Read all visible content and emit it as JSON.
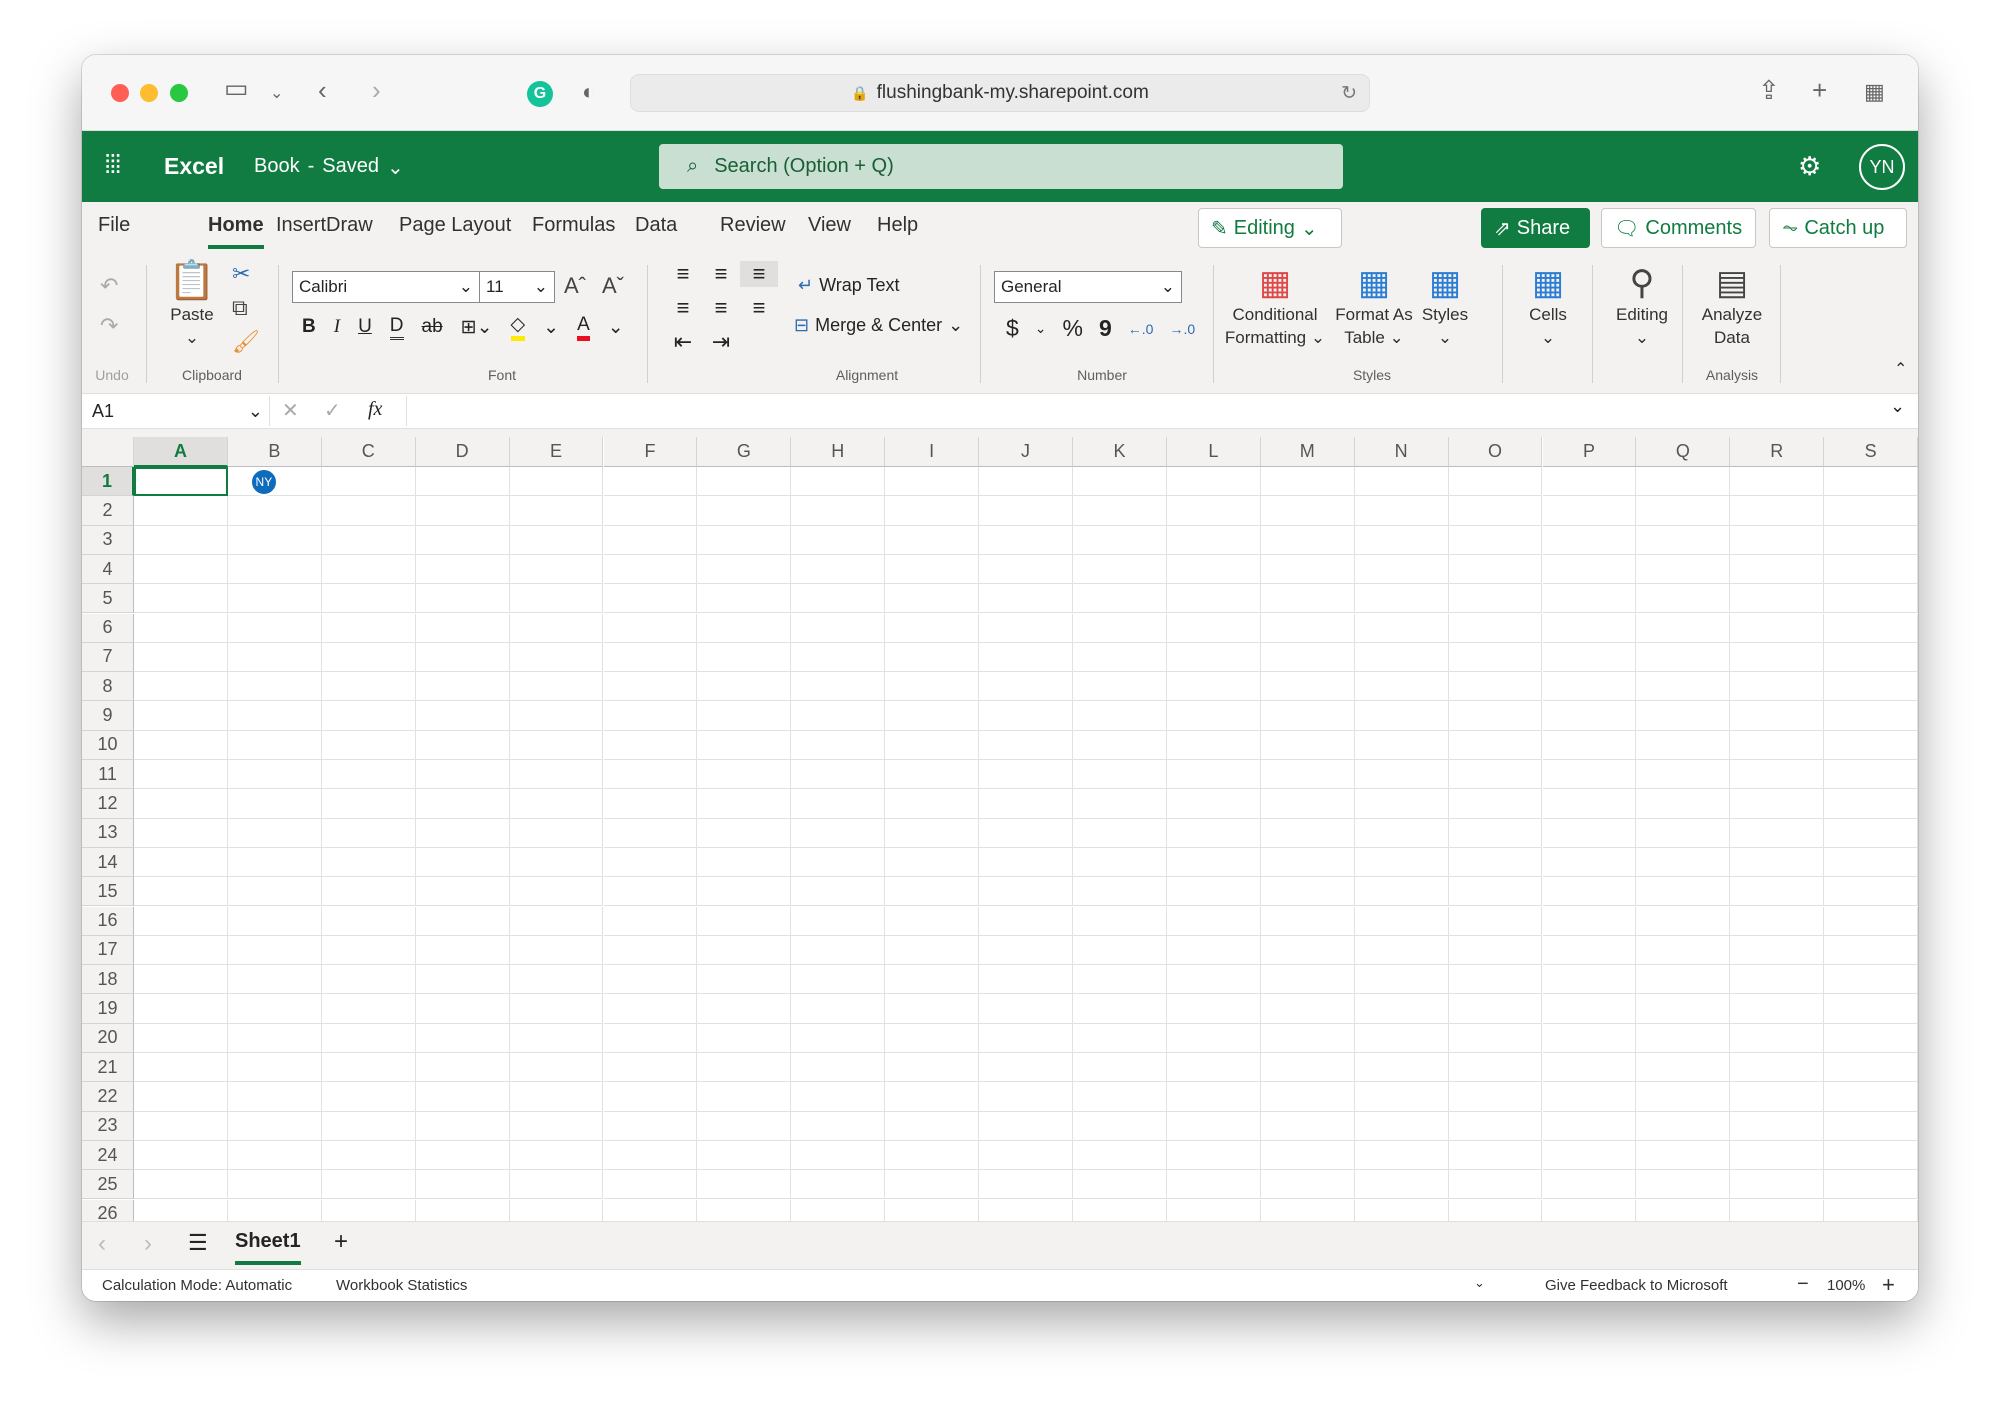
{
  "browser": {
    "url": "flushingbank-my.sharepoint.com",
    "traffic_lights": [
      "#ff5f57",
      "#febc2e",
      "#28c840"
    ]
  },
  "app": {
    "name": "Excel",
    "doc_title": "Book",
    "doc_status": "Saved",
    "separator": "-",
    "search_placeholder": "Search (Option + Q)",
    "user_initials": "YN",
    "brand_color": "#107c41"
  },
  "tabs": [
    {
      "label": "File"
    },
    {
      "label": "Home",
      "active": true
    },
    {
      "label": "Insert"
    },
    {
      "label": "Draw"
    },
    {
      "label": "Page Layout"
    },
    {
      "label": "Formulas"
    },
    {
      "label": "Data"
    },
    {
      "label": "Review"
    },
    {
      "label": "View"
    },
    {
      "label": "Help"
    }
  ],
  "top_buttons": {
    "editing": "Editing",
    "share": "Share",
    "comments": "Comments",
    "catch_up": "Catch up"
  },
  "ribbon": {
    "groups": {
      "undo": "Undo",
      "clipboard": "Clipboard",
      "font": "Font",
      "alignment": "Alignment",
      "number": "Number",
      "styles": "Styles",
      "analysis": "Analysis"
    },
    "paste": "Paste",
    "font_name": "Calibri",
    "font_size": "11",
    "wrap_text": "Wrap Text",
    "merge_center": "Merge & Center",
    "number_format": "General",
    "cond_fmt_1": "Conditional",
    "cond_fmt_2": "Formatting",
    "fmt_table_1": "Format As",
    "fmt_table_2": "Table",
    "styles": "Styles",
    "cells": "Cells",
    "editing": "Editing",
    "analyze_1": "Analyze",
    "analyze_2": "Data",
    "bold": "B",
    "italic": "I",
    "underline": "U",
    "double_underline": "D",
    "strike": "ab",
    "currency": "$",
    "percent": "%",
    "comma": "9"
  },
  "formula_bar": {
    "name_box": "A1",
    "fx": "fx",
    "value": ""
  },
  "grid": {
    "columns": [
      "A",
      "B",
      "C",
      "D",
      "E",
      "F",
      "G",
      "H",
      "I",
      "J",
      "K",
      "L",
      "M",
      "N",
      "O",
      "P",
      "Q",
      "R",
      "S"
    ],
    "rows": 26,
    "selected": "A1",
    "collaborator": {
      "initials": "NY",
      "cell": "B1",
      "color": "#0f6cbd"
    }
  },
  "sheets": {
    "tabs": [
      "Sheet1"
    ],
    "active": "Sheet1",
    "add": "+"
  },
  "status": {
    "calc_mode": "Calculation Mode: Automatic",
    "workbook_stats": "Workbook Statistics",
    "feedback": "Give Feedback to Microsoft",
    "zoom": "100%"
  }
}
